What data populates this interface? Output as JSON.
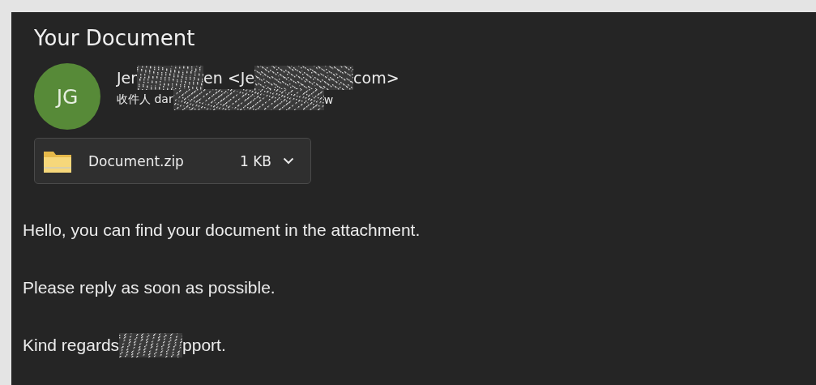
{
  "title": "Your Document",
  "sender": {
    "initials": "JG",
    "from_line": [
      {
        "kind": "text",
        "text": "Jer"
      },
      {
        "kind": "redaction"
      },
      {
        "kind": "text",
        "text": "en <Je"
      },
      {
        "kind": "redaction"
      },
      {
        "kind": "text",
        "text": "com>"
      }
    ],
    "to_line": [
      {
        "kind": "text",
        "text": "收件人 dar"
      },
      {
        "kind": "redaction"
      },
      {
        "kind": "text",
        "text": "w"
      }
    ]
  },
  "attachment": {
    "name": "Document.zip",
    "size": "1 KB"
  },
  "body": [
    {
      "parts": [
        {
          "kind": "text",
          "text": "Hello, you can find your document in the attachment."
        }
      ]
    },
    {
      "parts": [
        {
          "kind": "text",
          "text": "Please reply as soon as possible."
        }
      ]
    },
    {
      "parts": [
        {
          "kind": "text",
          "text": "Kind regards"
        },
        {
          "kind": "redaction"
        },
        {
          "kind": "text",
          "text": "pport."
        }
      ]
    }
  ]
}
